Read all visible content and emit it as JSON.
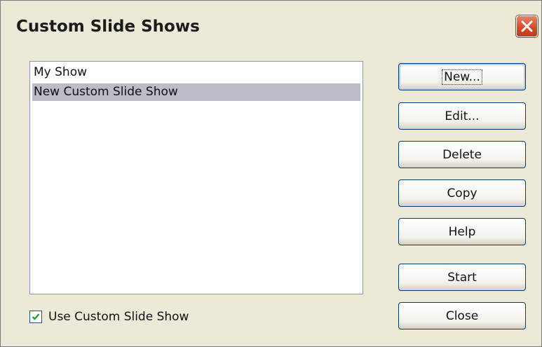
{
  "window": {
    "title": "Custom Slide Shows"
  },
  "list": {
    "items": [
      {
        "label": "My Show",
        "selected": false
      },
      {
        "label": "New Custom Slide Show",
        "selected": true
      }
    ]
  },
  "checkbox": {
    "label": "Use Custom Slide Show",
    "checked": true
  },
  "buttons": {
    "new": "New...",
    "edit": "Edit...",
    "delete": "Delete",
    "copy": "Copy",
    "help": "Help",
    "start": "Start",
    "close": "Close"
  },
  "icons": {
    "close": "close-icon",
    "check": "checkmark-icon"
  },
  "colors": {
    "selection": "#bcbcc8",
    "close_button": "#d2492a",
    "dialog_bg": "#ece9d8"
  }
}
